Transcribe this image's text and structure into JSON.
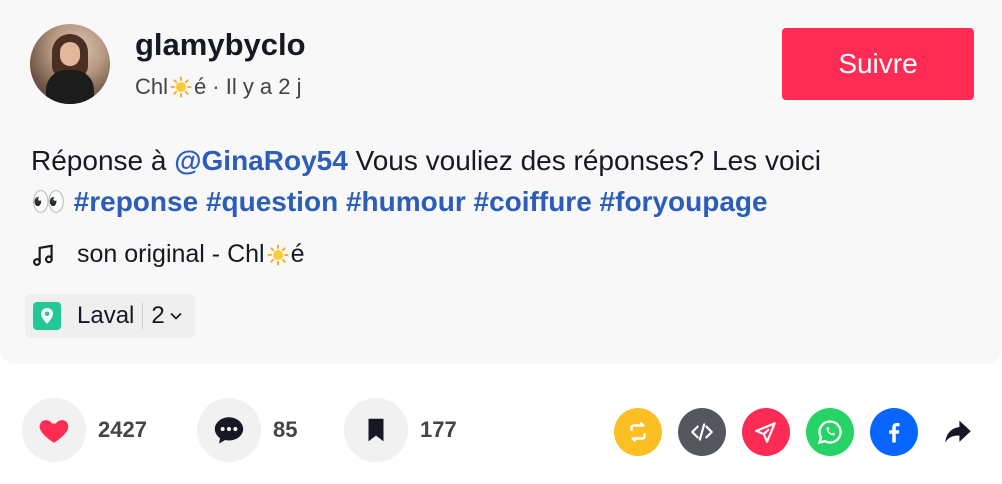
{
  "header": {
    "username": "glamybyclo",
    "display_name_prefix": "Chl",
    "display_name_suffix": "é",
    "time_ago": "· Il y a 2 j",
    "follow_label": "Suivre"
  },
  "description": {
    "prefix": "Réponse à",
    "mention": "@GinaRoy54",
    "text": "Vous vouliez des réponses? Les voici",
    "emoji": "👀",
    "hashtags": [
      "#reponse",
      "#question",
      "#humour",
      "#coiffure",
      "#foryoupage"
    ]
  },
  "music": {
    "label_prefix": "son original - Chl",
    "label_suffix": "é"
  },
  "location": {
    "name": "Laval",
    "count": "2"
  },
  "actions": {
    "likes": "2427",
    "comments": "85",
    "saves": "177"
  },
  "colors": {
    "brand": "#fe2c55",
    "link": "#2b5db9",
    "repost": "#fbbf24",
    "embed": "#55575e",
    "send": "#fe2c55",
    "whatsapp": "#25d366",
    "facebook": "#0866ff"
  },
  "icons": [
    "heart-icon",
    "comment-icon",
    "bookmark-icon",
    "repost-icon",
    "embed-icon",
    "send-icon",
    "whatsapp-icon",
    "facebook-icon",
    "share-arrow-icon",
    "music-note-icon",
    "location-pin-icon",
    "sun-emoji-icon"
  ]
}
